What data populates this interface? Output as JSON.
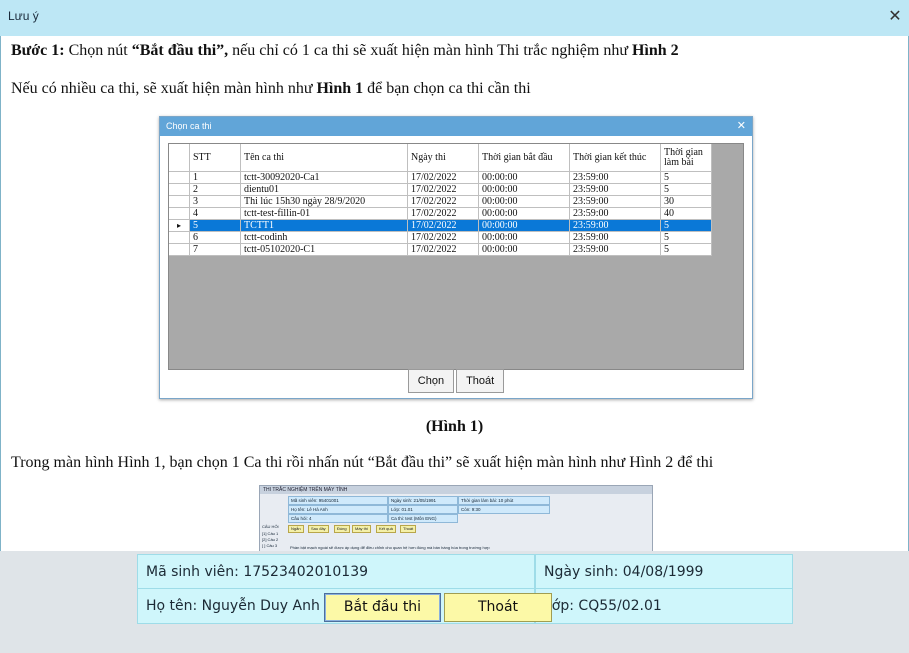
{
  "window": {
    "title": "Lưu ý"
  },
  "content": {
    "line1_bold": "Bước 1:",
    "line1_a": " Chọn nút ",
    "line1_btn": "“Bắt đầu thi”,",
    "line1_b": " nếu chỉ có 1 ca thi sẽ xuất hiện màn hình Thi trắc nghiệm như ",
    "line1_fig": "Hình 2",
    "line2_a": "Nếu có nhiều ca thi, sẽ xuất hiện màn hình như ",
    "line2_fig": "Hình 1",
    "line2_b": " để bạn chọn ca thi cần thi",
    "caption1": "(Hình 1)",
    "line3": "Trong màn hình Hình 1, bạn chọn 1 Ca thi rồi nhấn nút “Bắt đầu thi” sẽ xuất hiện màn hình như Hình 2 để thi"
  },
  "dialog": {
    "title": "Chọn ca thi",
    "columns": [
      "STT",
      "Tên ca thi",
      "Ngày thi",
      "Thời gian bắt đầu",
      "Thời gian kết thúc",
      "Thời gian làm bài"
    ],
    "rows": [
      [
        "1",
        "tctt-30092020-Ca1",
        "17/02/2022",
        "00:00:00",
        "23:59:00",
        "5"
      ],
      [
        "2",
        "dientu01",
        "17/02/2022",
        "00:00:00",
        "23:59:00",
        "5"
      ],
      [
        "3",
        "Thi lúc 15h30 ngày 28/9/2020",
        "17/02/2022",
        "00:00:00",
        "23:59:00",
        "30"
      ],
      [
        "4",
        "tctt-test-fillin-01",
        "17/02/2022",
        "00:00:00",
        "23:59:00",
        "40"
      ],
      [
        "5",
        "TCTT1",
        "17/02/2022",
        "00:00:00",
        "23:59:00",
        "5"
      ],
      [
        "6",
        "tctt-codinh",
        "17/02/2022",
        "00:00:00",
        "23:59:00",
        "5"
      ],
      [
        "7",
        "tctt-05102020-C1",
        "17/02/2022",
        "00:00:00",
        "23:59:00",
        "5"
      ]
    ],
    "selected_row_index": 4,
    "btn_choose": "Chọn",
    "btn_exit": "Thoát"
  },
  "thumbnail": {
    "title": "THI TRẮC NGHIỆM TRÊN MÁY TÍNH",
    "c1": "Mã sinh viên: 95401001",
    "c2": "Ngày sinh: 21/05/1991",
    "c3": "Thời gian làm bài: 10 phút",
    "c4": "Họ tên: Lê Hà Anh",
    "c5": "Lớp: 01.01",
    "c6": "Còn: 9:30",
    "c7": "Câu hỏi: 4",
    "c8": "Ca thi: test (Môn ENG)",
    "btns": [
      "Ngắn",
      "Sau đây",
      "Đúng",
      "Máy thi",
      "Kết quả",
      "Thoát"
    ],
    "left_head": "CÂU HỎI",
    "left_items": [
      "[1] Câu 1",
      "[2] Câu 2",
      "[ ] Câu 3"
    ],
    "question": "Phần bật mạch ngoài sẽ được áp dụng để điều chỉnh cho quan hệ hơn đúng mà bán hàng hóa trong trường hợp"
  },
  "student": {
    "student_id": "Mã sinh viên: 17523402010139",
    "dob": "Ngày sinh: 04/08/1999",
    "name": "Họ tên: Nguyễn Duy Anh",
    "class": "Lớp: CQ55/02.01"
  },
  "buttons": {
    "start": "Bắt đầu thi",
    "exit": "Thoát"
  },
  "colors": {
    "titlebar": "#bde7f5",
    "selection": "#0a78d7",
    "info_box": "#cff6fb",
    "button": "#fcf9a7"
  }
}
